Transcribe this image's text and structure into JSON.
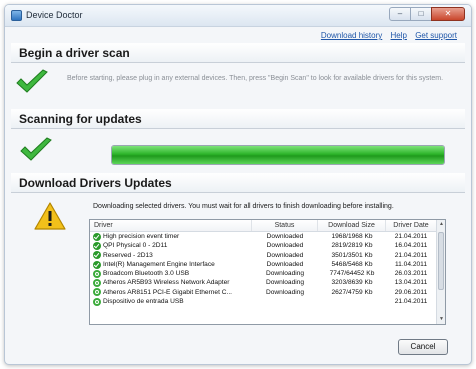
{
  "window": {
    "title": "Device Doctor",
    "controls": [
      "–",
      "□",
      "✕"
    ]
  },
  "toplinks": {
    "download_history": "Download history",
    "help": "Help",
    "get_support": "Get support"
  },
  "scan_section": {
    "heading": "Begin a driver scan",
    "text": "Before starting, please plug in any external devices. Then, press \"Begin Scan\" to look for available drivers for this system."
  },
  "updates_section": {
    "heading": "Scanning for updates",
    "progress": 1.0
  },
  "download_section": {
    "heading": "Download Drivers Updates",
    "text": "Downloading selected drivers. You must wait for all drivers to finish downloading before installing.",
    "columns": {
      "driver": "Driver",
      "status": "Status",
      "size": "Download Size",
      "date": "Driver Date"
    },
    "rows": [
      {
        "icon": "check-icon",
        "driver": "High precision event timer",
        "status": "Downloaded",
        "size": "1968/1968 Kb",
        "date": "21.04.2011"
      },
      {
        "icon": "check-icon",
        "driver": "QPI Physical 0 - 2D11",
        "status": "Downloaded",
        "size": "2819/2819 Kb",
        "date": "16.04.2011"
      },
      {
        "icon": "check-icon",
        "driver": "Reserved - 2D13",
        "status": "Downloaded",
        "size": "3501/3501 Kb",
        "date": "21.04.2011"
      },
      {
        "icon": "check-icon",
        "driver": "Intel(R) Management Engine Interface",
        "status": "Downloaded",
        "size": "5468/5468 Kb",
        "date": "11.04.2011"
      },
      {
        "icon": "download-icon",
        "driver": "Broadcom Bluetooth 3.0 USB",
        "status": "Downloading",
        "size": "7747/64452 Kb",
        "date": "26.03.2011"
      },
      {
        "icon": "download-icon",
        "driver": "Atheros AR5B93 Wireless Network Adapter",
        "status": "Downloading",
        "size": "3203/8639 Kb",
        "date": "13.04.2011"
      },
      {
        "icon": "download-icon",
        "driver": "Atheros AR8151 PCI-E Gigabit Ethernet C...",
        "status": "Downloading",
        "size": "2627/4759 Kb",
        "date": "29.06.2011"
      },
      {
        "icon": "download-icon",
        "driver": "Dispositivo de entrada USB",
        "status": "",
        "size": "",
        "date": "21.04.2011"
      }
    ]
  },
  "buttons": {
    "cancel": "Cancel"
  },
  "colors": {
    "accent_green": "#2db52a",
    "warning_yellow": "#f2c01b",
    "link_blue": "#1f56a8"
  }
}
